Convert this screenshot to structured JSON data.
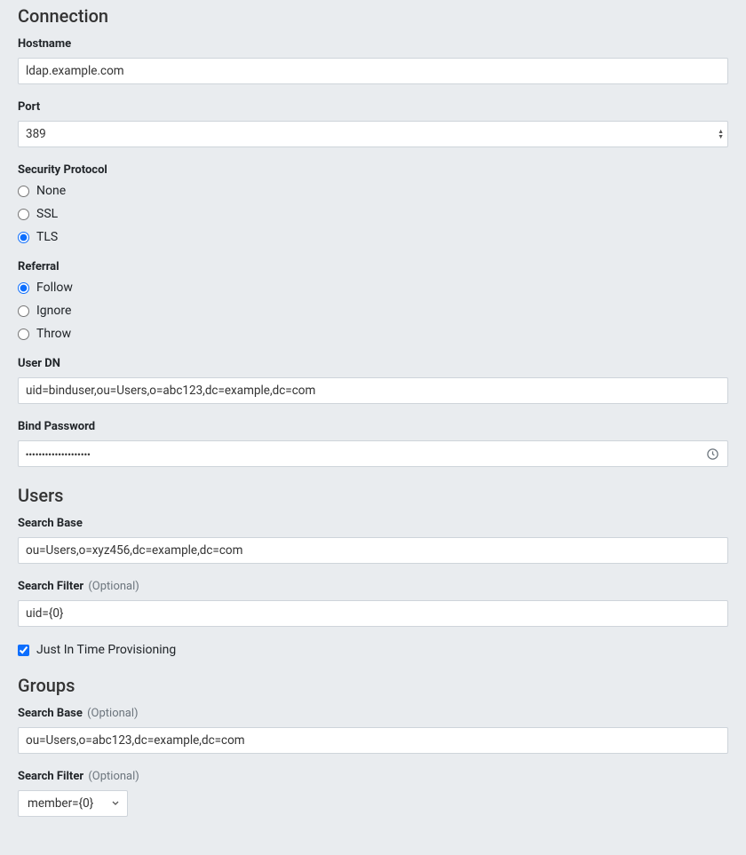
{
  "connection": {
    "title": "Connection",
    "hostname_label": "Hostname",
    "hostname_value": "ldap.example.com",
    "port_label": "Port",
    "port_value": "389",
    "security_protocol_label": "Security Protocol",
    "security_options": {
      "none": "None",
      "ssl": "SSL",
      "tls": "TLS"
    },
    "referral_label": "Referral",
    "referral_options": {
      "follow": "Follow",
      "ignore": "Ignore",
      "throw": "Throw"
    },
    "user_dn_label": "User DN",
    "user_dn_value": "uid=binduser,ou=Users,o=abc123,dc=example,dc=com",
    "bind_password_label": "Bind Password",
    "bind_password_mask": "••••••••••••••••••••"
  },
  "users": {
    "title": "Users",
    "search_base_label": "Search Base",
    "search_base_value": "ou=Users,o=xyz456,dc=example,dc=com",
    "search_filter_label": "Search Filter",
    "search_filter_value": "uid={0}",
    "jit_label": "Just In Time Provisioning"
  },
  "groups": {
    "title": "Groups",
    "search_base_label": "Search Base",
    "search_base_value": "ou=Users,o=abc123,dc=example,dc=com",
    "search_filter_label": "Search Filter",
    "search_filter_selected": "member={0}"
  },
  "optional_tag": "(Optional)"
}
